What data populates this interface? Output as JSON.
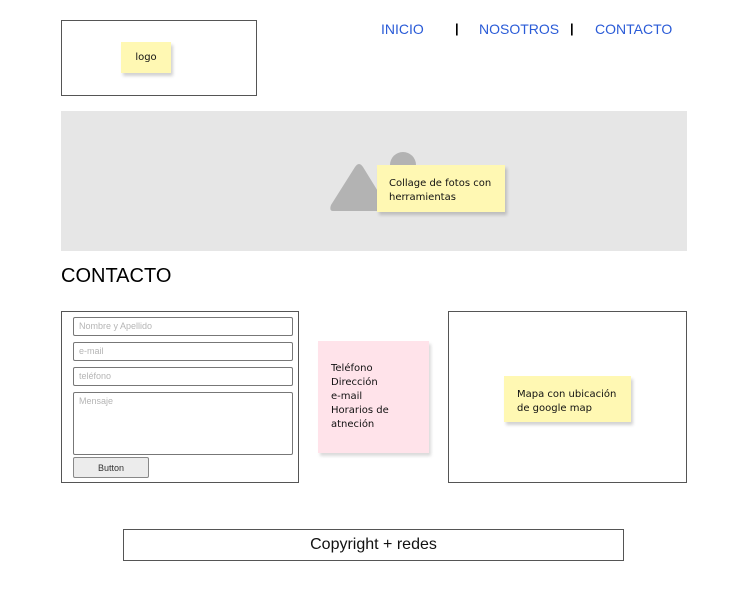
{
  "header": {
    "logo_note": "logo",
    "nav": {
      "inicio": "INICIO",
      "separator": "|",
      "nosotros": "NOSOTROS",
      "contacto": "CONTACTO"
    }
  },
  "hero": {
    "icon": "image-placeholder-icon",
    "note_line1": "Collage de fotos con",
    "note_line2": "herramientas"
  },
  "contact": {
    "heading": "CONTACTO",
    "form": {
      "name_placeholder": "Nombre y Apellido",
      "email_placeholder": "e-mail",
      "phone_placeholder": "teléfono",
      "message_placeholder": "Mensaje",
      "button_label": "Button"
    },
    "info_note": {
      "line1": "Teléfono",
      "line2": "Dirección",
      "line3": "e-mail",
      "line4": "Horarios de",
      "line5": "atneción"
    },
    "map_note": {
      "line1": "Mapa con ubicación",
      "line2": "de google map"
    }
  },
  "footer": {
    "text": "Copyright + redes"
  },
  "colors": {
    "nav_link": "#2a5bd7",
    "hero_bg": "#e6e6e6",
    "note_yellow": "#fff8b3",
    "note_pink": "#ffe3ea"
  }
}
